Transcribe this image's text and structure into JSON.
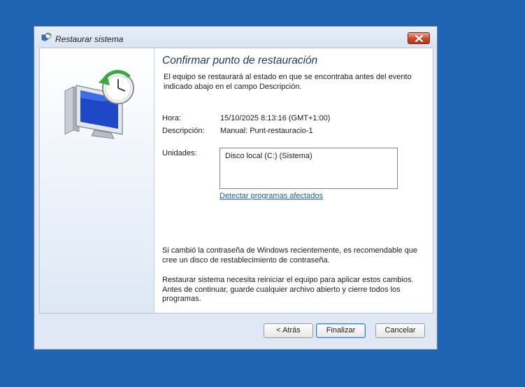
{
  "window": {
    "title": "Restaurar sistema"
  },
  "page": {
    "heading": "Confirmar punto de restauración",
    "intro": "El equipo se restaurará al estado en que se encontraba antes del evento indicado abajo en el campo Descripción.",
    "time_label": "Hora:",
    "time_value": "15/10/2025 8:13:16 (GMT+1:00)",
    "description_label": "Descripción:",
    "description_value": "Manual: Punt-restauracio-1",
    "drives_label": "Unidades:",
    "drives": [
      "Disco local (C:) (Sistema)"
    ],
    "scan_link": "Detectar programas afectados",
    "password_note": "Si cambió la contraseña de Windows recientemente, es recomendable que cree un disco de restablecimiento de contraseña.",
    "restart_note": "Restaurar sistema necesita reiniciar el equipo para aplicar estos cambios. Antes de continuar, guarde cualquier archivo abierto y cierre todos los programas."
  },
  "buttons": {
    "back": "< Atrás",
    "finish": "Finalizar",
    "cancel": "Cancelar"
  },
  "icons": {
    "title": "system-restore-icon",
    "close": "close-icon",
    "hero": "system-restore-computer-icon"
  },
  "colors": {
    "desktop": "#1f63b3",
    "heading": "#1d3b68",
    "link": "#1a5fb4",
    "close_button": "#c74a2c"
  }
}
